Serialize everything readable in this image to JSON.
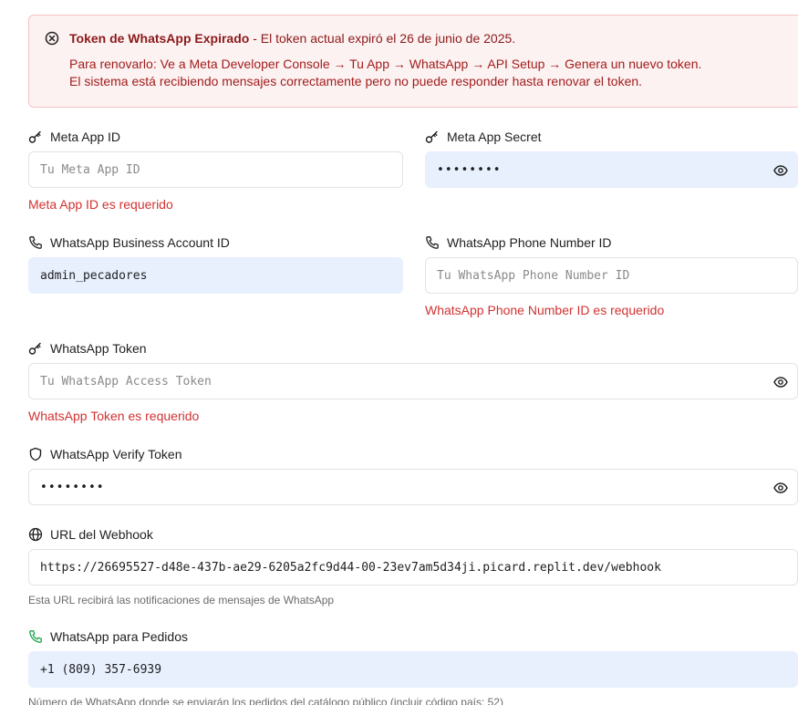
{
  "alert": {
    "title": "Token de WhatsApp Expirado",
    "title_suffix": " - El token actual expiró el 26 de junio de 2025.",
    "line2": "Para renovarlo: Ve a Meta Developer Console → Tu App → WhatsApp → API Setup → Genera un nuevo token.",
    "line3": "El sistema está recibiendo mensajes correctamente pero no puede responder hasta renovar el token.",
    "icon": "x-circle-icon"
  },
  "fields": {
    "meta_app_id": {
      "label": "Meta App ID",
      "placeholder": "Tu Meta App ID",
      "value": "",
      "error": "Meta App ID es requerido",
      "icon": "key-icon"
    },
    "meta_app_secret": {
      "label": "Meta App Secret",
      "value": "••••••••",
      "icon": "key-icon"
    },
    "business_account_id": {
      "label": "WhatsApp Business Account ID",
      "value": "admin_pecadores",
      "icon": "phone-icon"
    },
    "phone_number_id": {
      "label": "WhatsApp Phone Number ID",
      "placeholder": "Tu WhatsApp Phone Number ID",
      "value": "",
      "error": "WhatsApp Phone Number ID es requerido",
      "icon": "phone-icon"
    },
    "token": {
      "label": "WhatsApp Token",
      "placeholder": "Tu WhatsApp Access Token",
      "value": "",
      "error": "WhatsApp Token es requerido",
      "icon": "key-icon"
    },
    "verify_token": {
      "label": "WhatsApp Verify Token",
      "value": "••••••••",
      "icon": "shield-icon"
    },
    "webhook_url": {
      "label": "URL del Webhook",
      "value": "https://26695527-d48e-437b-ae29-6205a2fc9d44-00-23ev7am5d34ji.picard.replit.dev/webhook",
      "help": "Esta URL recibirá las notificaciones de mensajes de WhatsApp",
      "icon": "globe-icon"
    },
    "orders_phone": {
      "label": "WhatsApp para Pedidos",
      "value": "+1 (809) 357-6939",
      "help": "Número de WhatsApp donde se enviarán los pedidos del catálogo público (incluir código país: 52)",
      "icon": "phone-icon"
    }
  },
  "colors": {
    "alert_bg": "#fdf2f2",
    "alert_text": "#a11d1d",
    "error": "#d23232",
    "autofill_bg": "#e8f0fe",
    "phone_accent": "#16a34a"
  }
}
